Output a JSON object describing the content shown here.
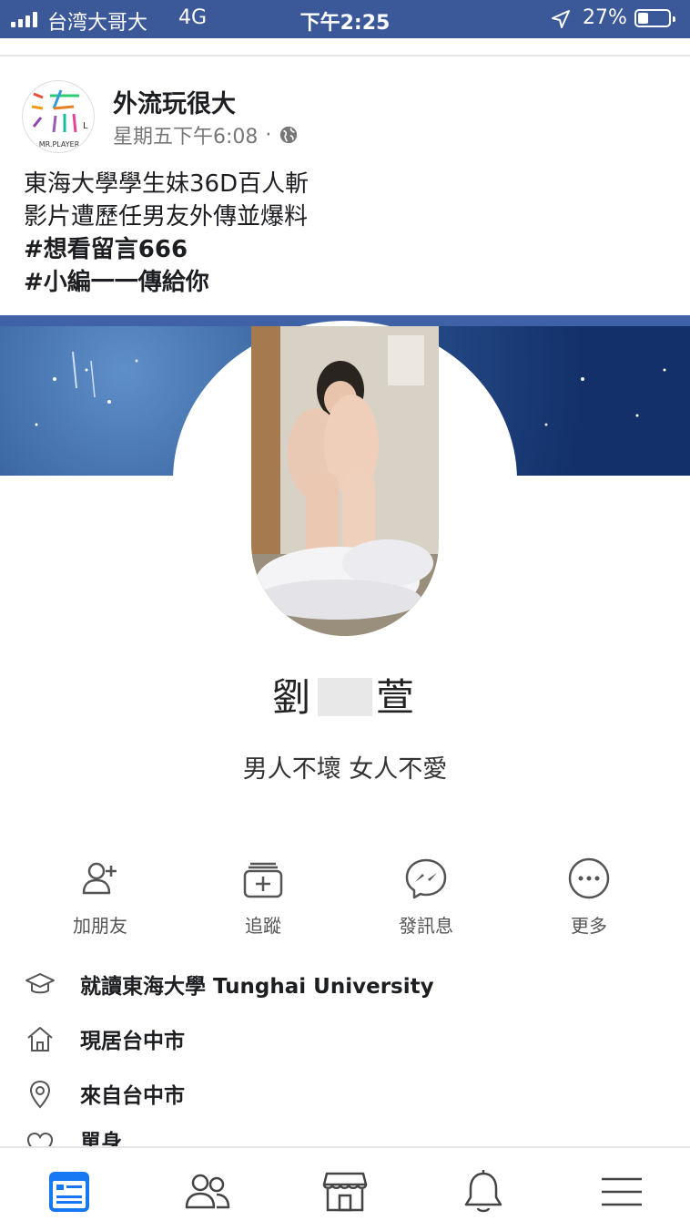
{
  "status_bar": {
    "carrier": "台湾大哥大",
    "network": "4G",
    "time": "下午2:25",
    "battery_percent": "27%",
    "battery_level": 0.27
  },
  "post": {
    "page_name": "外流玩很大",
    "avatar_text": "MR.PLAYER",
    "timestamp": "星期五下午6:08",
    "meta_separator": "·",
    "text_lines": [
      "東海大學學生妹36D百人斬",
      "影片遭歷任男友外傳並爆料",
      "#想看留言666",
      "#小編一一傳給你"
    ]
  },
  "profile": {
    "name_first": "劉",
    "name_last": "萱",
    "bio": "男人不壞 女人不愛",
    "actions": [
      {
        "label": "加朋友",
        "icon": "add-friend-icon"
      },
      {
        "label": "追蹤",
        "icon": "follow-icon"
      },
      {
        "label": "發訊息",
        "icon": "messenger-icon"
      },
      {
        "label": "更多",
        "icon": "more-icon"
      }
    ],
    "info": [
      {
        "icon": "graduation-cap-icon",
        "text": "就讀東海大學 Tunghai University"
      },
      {
        "icon": "home-icon",
        "text": "現居台中市"
      },
      {
        "icon": "location-pin-icon",
        "text": "來自台中市"
      },
      {
        "icon": "heart-icon",
        "text": "單身"
      }
    ]
  },
  "bottom_nav": [
    "news-feed-icon",
    "friends-icon",
    "marketplace-icon",
    "notifications-icon",
    "menu-icon"
  ],
  "colors": {
    "brand": "#3b5998",
    "active_nav": "#1877f2"
  }
}
